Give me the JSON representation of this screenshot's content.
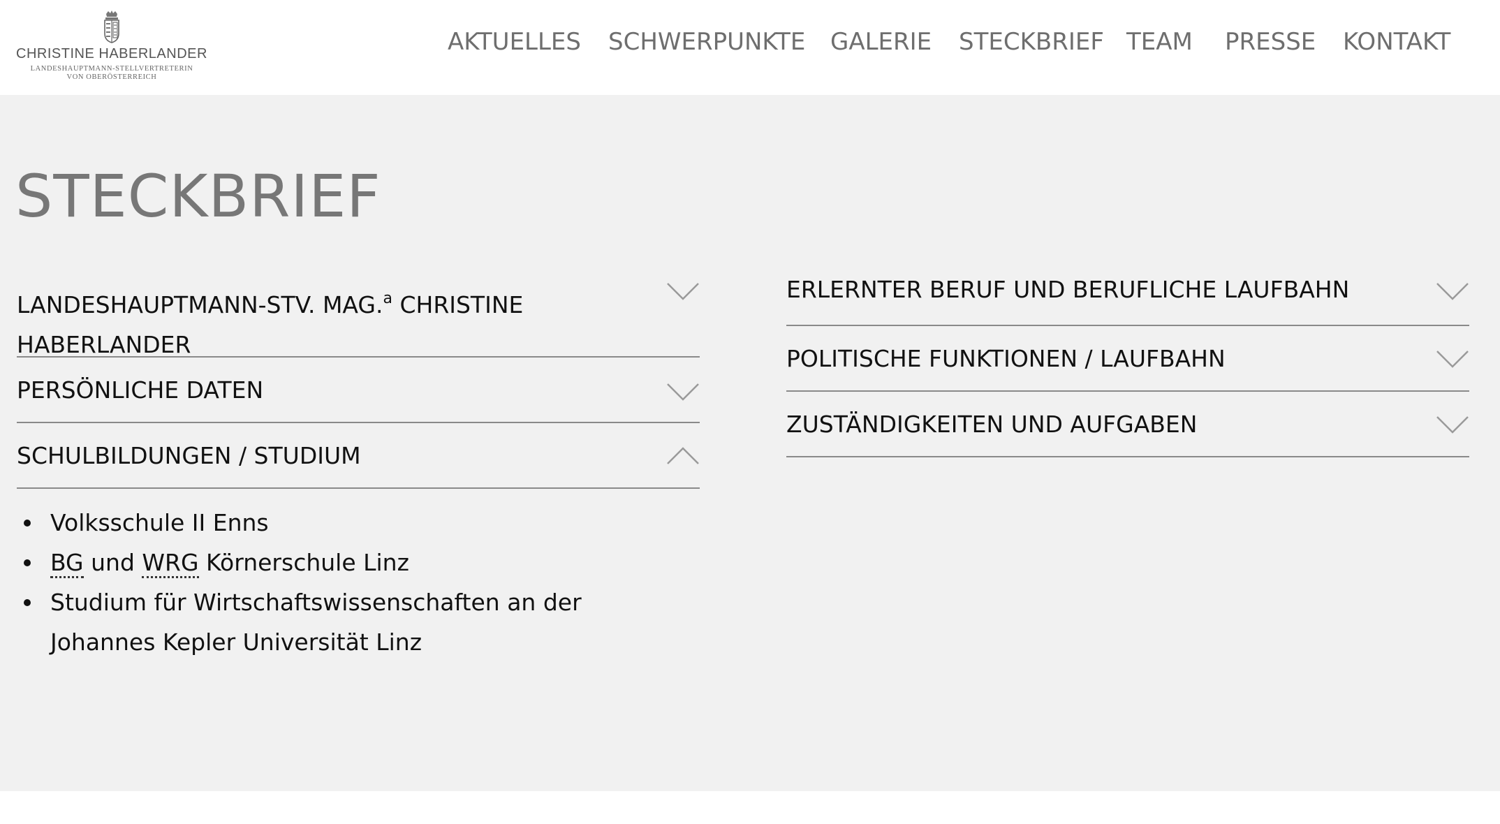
{
  "logo": {
    "name": "CHRISTINE HABERLANDER",
    "sub_line1": "LANDESHAUPTMANN-STELLVERTRETERIN",
    "sub_line2": "VON OBERÖSTERREICH",
    "crest_icon": "coat-of-arms-icon"
  },
  "nav": {
    "items": [
      {
        "label": "AKTUELLES"
      },
      {
        "label": "SCHWERPUNKTE"
      },
      {
        "label": "GALERIE"
      },
      {
        "label": "STECKBRIEF"
      },
      {
        "label": "TEAM"
      },
      {
        "label": "PRESSE"
      },
      {
        "label": "KONTAKT"
      }
    ]
  },
  "page": {
    "title": "STECKBRIEF"
  },
  "left_column": {
    "item1": {
      "label_main": "LANDESHAUPTMANN-STV. MAG.",
      "label_sup": "a",
      "label_rest": " CHRISTINE HABERLANDER",
      "expanded": false
    },
    "item2": {
      "label": "PERSÖNLICHE DATEN",
      "expanded": false
    },
    "item3": {
      "label": "SCHULBILDUNGEN / STUDIUM",
      "expanded": true,
      "content": {
        "li1": "Volksschule II Enns",
        "li2_abbr1": "BG",
        "li2_mid": " und ",
        "li2_abbr2": "WRG",
        "li2_rest": " Körnerschule Linz",
        "li3": "Studium für Wirtschaftswissenschaften an der Johannes Kepler Universität Linz"
      }
    }
  },
  "right_column": {
    "item1": {
      "label": "ERLERNTER BERUF UND BERUFLICHE LAUFBAHN",
      "expanded": false
    },
    "item2": {
      "label": "POLITISCHE FUNKTIONEN / LAUFBAHN",
      "expanded": false
    },
    "item3": {
      "label": "ZUSTÄNDIGKEITEN UND AUFGABEN",
      "expanded": false
    }
  },
  "colors": {
    "background_main": "#f1f1f1",
    "header_bg": "#ffffff",
    "nav_text": "#6e6e6e",
    "title_text": "#777777",
    "divider": "#8a8a8a",
    "chevron": "#9a9a9a"
  }
}
